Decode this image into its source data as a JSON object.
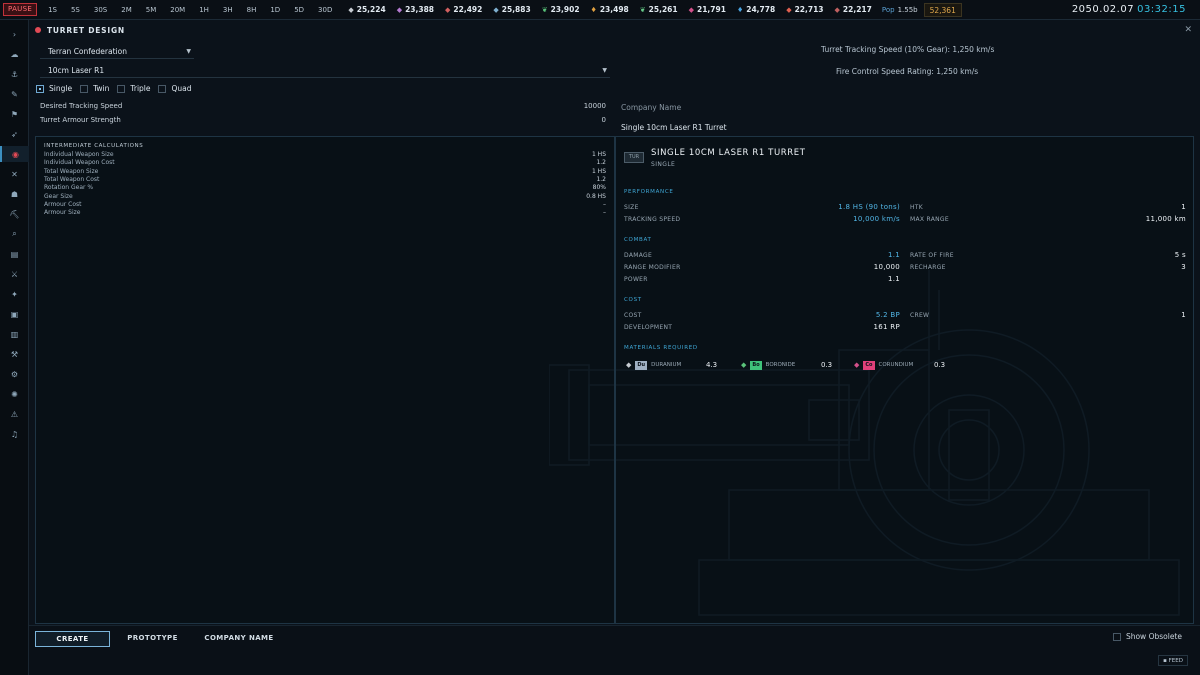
{
  "topbar": {
    "pause": "PAUSE",
    "speeds": [
      "1S",
      "5S",
      "30S",
      "2M",
      "5M",
      "20M",
      "1H",
      "3H",
      "8H",
      "1D",
      "5D",
      "30D"
    ],
    "resources": [
      {
        "icon": "crystal-icon",
        "glyph": "◆",
        "color": "#c7ccd2",
        "value": "25,224"
      },
      {
        "icon": "ore-icon",
        "glyph": "◆",
        "color": "#b57bd1",
        "value": "23,388"
      },
      {
        "icon": "ore-icon",
        "glyph": "◆",
        "color": "#d36060",
        "value": "22,492"
      },
      {
        "icon": "ore-icon",
        "glyph": "◆",
        "color": "#7fb0d0",
        "value": "25,883"
      },
      {
        "icon": "leaf-icon",
        "glyph": "❦",
        "color": "#59c37a",
        "value": "23,902"
      },
      {
        "icon": "flame-icon",
        "glyph": "♦",
        "color": "#e0a040",
        "value": "23,498"
      },
      {
        "icon": "leaf-icon",
        "glyph": "❦",
        "color": "#66c988",
        "value": "25,261"
      },
      {
        "icon": "ore-icon",
        "glyph": "◆",
        "color": "#d2508a",
        "value": "21,791"
      },
      {
        "icon": "drop-icon",
        "glyph": "♦",
        "color": "#4aa3e0",
        "value": "24,778"
      },
      {
        "icon": "ore-icon",
        "glyph": "◆",
        "color": "#e06050",
        "value": "22,713"
      },
      {
        "icon": "ore-icon",
        "glyph": "◆",
        "color": "#c06060",
        "value": "22,217"
      }
    ],
    "pop_label": "Pop",
    "pop_value": "1.55b",
    "wealth": "52,361",
    "date": "2050.02.07",
    "time": "03:32:15"
  },
  "sidebar": [
    {
      "name": "expand-icon",
      "glyph": "›"
    },
    {
      "name": "colony-icon",
      "glyph": "☁"
    },
    {
      "name": "anchor-icon",
      "glyph": "⚓"
    },
    {
      "name": "wrench-icon",
      "glyph": "✎"
    },
    {
      "name": "flag-icon",
      "glyph": "⚑"
    },
    {
      "name": "rocket-icon",
      "glyph": "➶"
    },
    {
      "name": "turret-design-icon",
      "glyph": "◉"
    },
    {
      "name": "close-x-icon",
      "glyph": "✕"
    },
    {
      "name": "person-icon",
      "glyph": "☗"
    },
    {
      "name": "pickaxe-icon",
      "glyph": "⛏"
    },
    {
      "name": "telescope-icon",
      "glyph": "⌕"
    },
    {
      "name": "clipboard-icon",
      "glyph": "▤"
    },
    {
      "name": "swords-icon",
      "glyph": "⚔"
    },
    {
      "name": "tag-icon",
      "glyph": "✦"
    },
    {
      "name": "box-icon",
      "glyph": "▣"
    },
    {
      "name": "report-icon",
      "glyph": "▥"
    },
    {
      "name": "tool-icon",
      "glyph": "⚒"
    },
    {
      "name": "gear-icon",
      "glyph": "⚙"
    },
    {
      "name": "galaxy-icon",
      "glyph": "✺"
    },
    {
      "name": "warning-icon",
      "glyph": "⚠"
    },
    {
      "name": "music-icon",
      "glyph": "♫"
    }
  ],
  "window": {
    "title": "TURRET DESIGN",
    "empire_select": "Terran Confederation",
    "weapon_select": "10cm Laser R1",
    "mounts": [
      {
        "label": "Single",
        "checked": true
      },
      {
        "label": "Twin",
        "checked": false
      },
      {
        "label": "Triple",
        "checked": false
      },
      {
        "label": "Quad",
        "checked": false
      }
    ],
    "desired_tracking_label": "Desired Tracking Speed",
    "desired_tracking_value": "10000",
    "armour_label": "Turret Armour Strength",
    "armour_value": "0",
    "tracking_info": "Turret Tracking Speed (10% Gear): 1,250 km/s",
    "fire_control_info": "Fire Control Speed Rating: 1,250 km/s",
    "company_label": "Company Name",
    "company_value": "Single 10cm Laser R1 Turret"
  },
  "calc": {
    "title": "INTERMEDIATE CALCULATIONS",
    "rows": [
      {
        "label": "Individual Weapon Size",
        "value": "1 HS"
      },
      {
        "label": "Individual Weapon Cost",
        "value": "1.2"
      },
      {
        "label": "Total Weapon Size",
        "value": "1 HS"
      },
      {
        "label": "Total Weapon Cost",
        "value": "1.2"
      },
      {
        "label": "Rotation Gear %",
        "value": "80%"
      },
      {
        "label": "Gear Size",
        "value": "0.8 HS"
      },
      {
        "label": "Armour Cost",
        "value": "–"
      },
      {
        "label": "Armour Size",
        "value": "–"
      }
    ]
  },
  "summary": {
    "badge": "TUR",
    "title": "SINGLE 10CM LASER R1 TURRET",
    "subtitle": "SINGLE",
    "performance_head": "PERFORMANCE",
    "size_label": "SIZE",
    "size_value": "1.8 HS (90 tons)",
    "htk_label": "HTK",
    "htk_value": "1",
    "tracking_label": "TRACKING SPEED",
    "tracking_value": "10,000 km/s",
    "range_label": "MAX RANGE",
    "range_value": "11,000 km",
    "combat_head": "COMBAT",
    "damage_label": "DAMAGE",
    "damage_value": "1.1",
    "rof_label": "RATE OF FIRE",
    "rof_value": "5 s",
    "rangemod_label": "RANGE MODIFIER",
    "rangemod_value": "10,000",
    "recharge_label": "RECHARGE",
    "recharge_value": "3",
    "power_label": "POWER",
    "power_value": "1.1",
    "cost_head": "COST",
    "cost_label": "COST",
    "cost_value": "5.2 BP",
    "crew_label": "CREW",
    "crew_value": "1",
    "dev_label": "DEVELOPMENT",
    "dev_value": "161 RP",
    "materials_head": "MATERIALS REQUIRED",
    "materials": [
      {
        "code": "Du",
        "name": "DURANIUM",
        "amount": "4.3",
        "color": "#9fb0c2",
        "icon_color": "#c7ccd2"
      },
      {
        "code": "Bo",
        "name": "BORONIDE",
        "amount": "0.3",
        "color": "#3fc27a",
        "icon_color": "#59c37a"
      },
      {
        "code": "Co",
        "name": "CORUNDIUM",
        "amount": "0.3",
        "color": "#e0407a",
        "icon_color": "#d2508a"
      }
    ]
  },
  "bottom": {
    "tabs": [
      "CREATE",
      "PROTOTYPE",
      "COMPANY NAME"
    ],
    "show_obsolete": "Show Obsolete",
    "feed": "FEED"
  }
}
